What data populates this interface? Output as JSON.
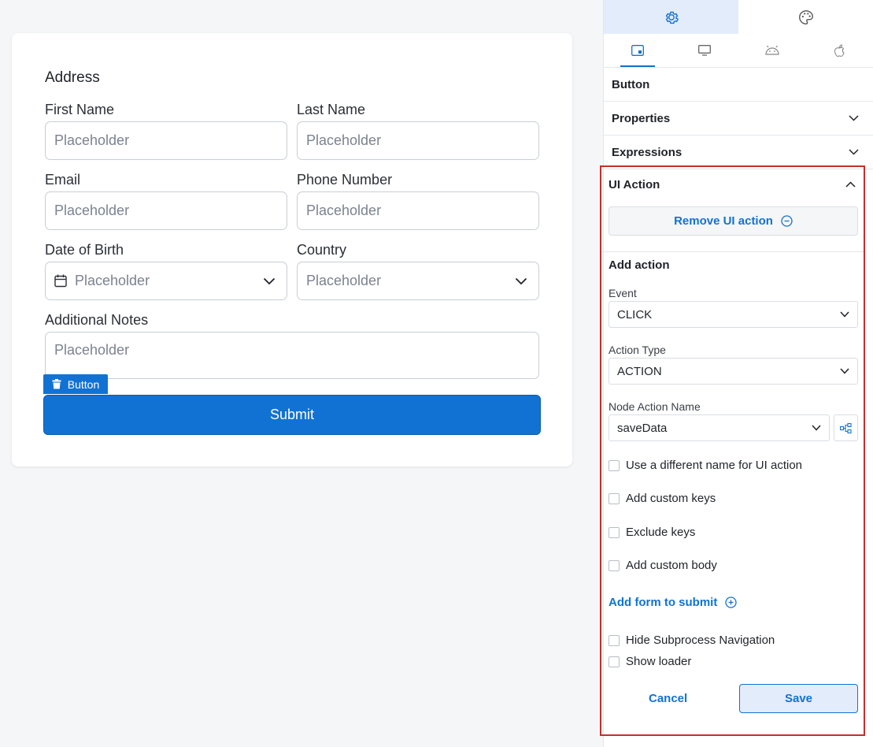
{
  "form": {
    "title": "Address",
    "first_name": {
      "label": "First Name",
      "placeholder": "Placeholder"
    },
    "last_name": {
      "label": "Last Name",
      "placeholder": "Placeholder"
    },
    "email": {
      "label": "Email",
      "placeholder": "Placeholder"
    },
    "phone": {
      "label": "Phone Number",
      "placeholder": "Placeholder"
    },
    "dob": {
      "label": "Date of Birth",
      "placeholder": "Placeholder"
    },
    "country": {
      "label": "Country",
      "placeholder": "Placeholder"
    },
    "notes": {
      "label": "Additional Notes",
      "placeholder": "Placeholder"
    },
    "button_tag": "Button",
    "submit_label": "Submit"
  },
  "panel": {
    "top_tabs": [
      "settings-icon",
      "palette-icon"
    ],
    "sub_tabs": [
      "tablet-icon",
      "desktop-icon",
      "android-icon",
      "apple-icon"
    ],
    "component_name": "Button",
    "sections": {
      "properties": "Properties",
      "expressions": "Expressions"
    },
    "ui_action": {
      "title": "UI Action",
      "remove_label": "Remove UI action",
      "add_action_title": "Add action",
      "event_label": "Event",
      "event_value": "CLICK",
      "action_type_label": "Action Type",
      "action_type_value": "ACTION",
      "node_action_label": "Node Action Name",
      "node_action_value": "saveData",
      "checks": {
        "different_name": "Use a different name for UI action",
        "custom_keys": "Add custom keys",
        "exclude_keys": "Exclude keys",
        "custom_body": "Add custom body",
        "hide_subprocess": "Hide Subprocess Navigation",
        "show_loader": "Show loader"
      },
      "add_form_link": "Add form to submit",
      "cancel_label": "Cancel",
      "save_label": "Save"
    }
  },
  "colors": {
    "accent": "#1272d3",
    "highlight_border": "#c0312b"
  }
}
